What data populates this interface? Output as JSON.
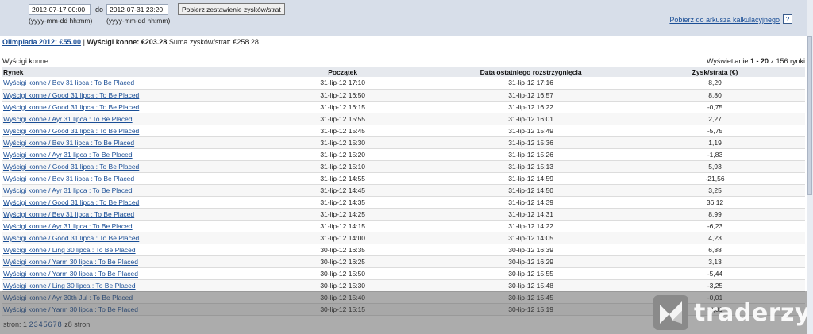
{
  "filter": {
    "date_from": "2012-07-17 00:00",
    "date_to": "2012-07-31 23:20",
    "do_label": "do",
    "hint_from": "(yyyy-mm-dd hh:mm)",
    "hint_to": "(yyyy-mm-dd hh:mm)",
    "fetch_button": "Pobierz zestawienie zysków/strat",
    "export_link": "Pobierz do arkusza kalkulacyjnego",
    "help_label": "?"
  },
  "summary": {
    "olympics_link": "Olimpiada 2012: €55.00",
    "separator": "|",
    "horse_racing": "Wyścigi konne: €203.28",
    "total_label": "Suma zysków/strat:",
    "total_value": "€258.28"
  },
  "section_title": "Wyścigi konne",
  "display": {
    "prefix": "Wyświetlanie",
    "range": "1 - 20",
    "suffix": "z 156 rynki"
  },
  "table": {
    "headers": [
      "Rynek",
      "Początek",
      "Data ostatniego rozstrzygnięcia",
      "Zysk/strata (€)"
    ],
    "rows": [
      [
        "Wyścigi konne / Bev 31 lipca : To Be Placed",
        "31-lip-12 17:10",
        "31-lip-12 17:16",
        "8,29"
      ],
      [
        "Wyścigi konne / Good 31 lipca : To Be Placed",
        "31-lip-12 16:50",
        "31-lip-12 16:57",
        "8,80"
      ],
      [
        "Wyścigi konne / Good 31 lipca : To Be Placed",
        "31-lip-12 16:15",
        "31-lip-12 16:22",
        "-0,75"
      ],
      [
        "Wyścigi konne / Ayr 31 lipca : To Be Placed",
        "31-lip-12 15:55",
        "31-lip-12 16:01",
        "2,27"
      ],
      [
        "Wyścigi konne / Good 31 lipca : To Be Placed",
        "31-lip-12 15:45",
        "31-lip-12 15:49",
        "-5,75"
      ],
      [
        "Wyścigi konne / Bev 31 lipca : To Be Placed",
        "31-lip-12 15:30",
        "31-lip-12 15:36",
        "1,19"
      ],
      [
        "Wyścigi konne / Ayr 31 lipca : To Be Placed",
        "31-lip-12 15:20",
        "31-lip-12 15:26",
        "-1,83"
      ],
      [
        "Wyścigi konne / Good 31 lipca : To Be Placed",
        "31-lip-12 15:10",
        "31-lip-12 15:13",
        "5,93"
      ],
      [
        "Wyścigi konne / Bev 31 lipca : To Be Placed",
        "31-lip-12 14:55",
        "31-lip-12 14:59",
        "-21,56"
      ],
      [
        "Wyścigi konne / Ayr 31 lipca : To Be Placed",
        "31-lip-12 14:45",
        "31-lip-12 14:50",
        "3,25"
      ],
      [
        "Wyścigi konne / Good 31 lipca : To Be Placed",
        "31-lip-12 14:35",
        "31-lip-12 14:39",
        "36,12"
      ],
      [
        "Wyścigi konne / Bev 31 lipca : To Be Placed",
        "31-lip-12 14:25",
        "31-lip-12 14:31",
        "8,99"
      ],
      [
        "Wyścigi konne / Ayr 31 lipca : To Be Placed",
        "31-lip-12 14:15",
        "31-lip-12 14:22",
        "-6,23"
      ],
      [
        "Wyścigi konne / Good 31 lipca : To Be Placed",
        "31-lip-12 14:00",
        "31-lip-12 14:05",
        "4,23"
      ],
      [
        "Wyścigi konne / Ling 30 lipca : To Be Placed",
        "30-lip-12 16:35",
        "30-lip-12 16:39",
        "6,88"
      ],
      [
        "Wyścigi konne / Yarm 30 lipca : To Be Placed",
        "30-lip-12 16:25",
        "30-lip-12 16:29",
        "3,13"
      ],
      [
        "Wyścigi konne / Yarm 30 lipca : To Be Placed",
        "30-lip-12 15:50",
        "30-lip-12 15:55",
        "-5,44"
      ],
      [
        "Wyścigi konne / Ling 30 lipca : To Be Placed",
        "30-lip-12 15:30",
        "30-lip-12 15:48",
        "-3,25"
      ],
      [
        "Wyścigi konne / Ayr 30th Jul : To Be Placed",
        "30-lip-12 15:40",
        "30-lip-12 15:45",
        "-0,01"
      ],
      [
        "Wyścigi konne / Yarm 30 lipca : To Be Placed",
        "30-lip-12 15:15",
        "30-lip-12 15:19",
        "-0,01"
      ]
    ]
  },
  "pager": {
    "label": "stron:",
    "current": "1",
    "pages": [
      "2",
      "3",
      "4",
      "5",
      "6",
      "7",
      "8"
    ],
    "suffix": "z8 stron"
  },
  "watermark": {
    "text": "traderzy.pl",
    "icon": "traderzy-logo-icon"
  }
}
